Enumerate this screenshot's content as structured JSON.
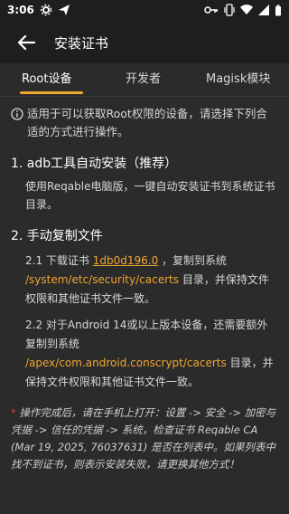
{
  "status": {
    "time": "3:06"
  },
  "header": {
    "title": "安装证书"
  },
  "tabs": [
    {
      "label": "Root设备"
    },
    {
      "label": "开发者"
    },
    {
      "label": "Magisk模块"
    }
  ],
  "content": {
    "intro": "适用于可以获取Root权限的设备，请选择下列合适的方式进行操作。",
    "section1": {
      "title": "1. adb工具自动安装（推荐）",
      "body": "使用Reqable电脑版，一键自动安装证书到系统证书目录。"
    },
    "section2": {
      "title": "2. 手动复制文件",
      "step1_prefix": "2.1 下载证书",
      "step1_link": "1db0d196.0",
      "step1_middle": "，复制到系统",
      "step1_path": "/system/etc/security/cacerts",
      "step1_suffix": "目录，并保持文件权限和其他证书文件一致。",
      "step2_prefix": "2.2 对于Android 14或以上版本设备，还需要额外复制到系统",
      "step2_path": "/apex/com.android.conscrypt/cacerts",
      "step2_suffix": "目录，并保持文件权限和其他证书文件一致。"
    },
    "note_star": "*",
    "note": "操作完成后，请在手机上打开：设置 -> 安全 -> 加密与凭据 -> 信任的凭据 -> 系统，检查证书 Reqable CA (Mar 19, 2025, 76037631) 是否在列表中。如果列表中找不到证书，则表示安装失败，请更换其他方式！"
  },
  "colors": {
    "accent": "#f2a531",
    "background": "#2b2b2b",
    "bar": "#1e1e1e"
  }
}
